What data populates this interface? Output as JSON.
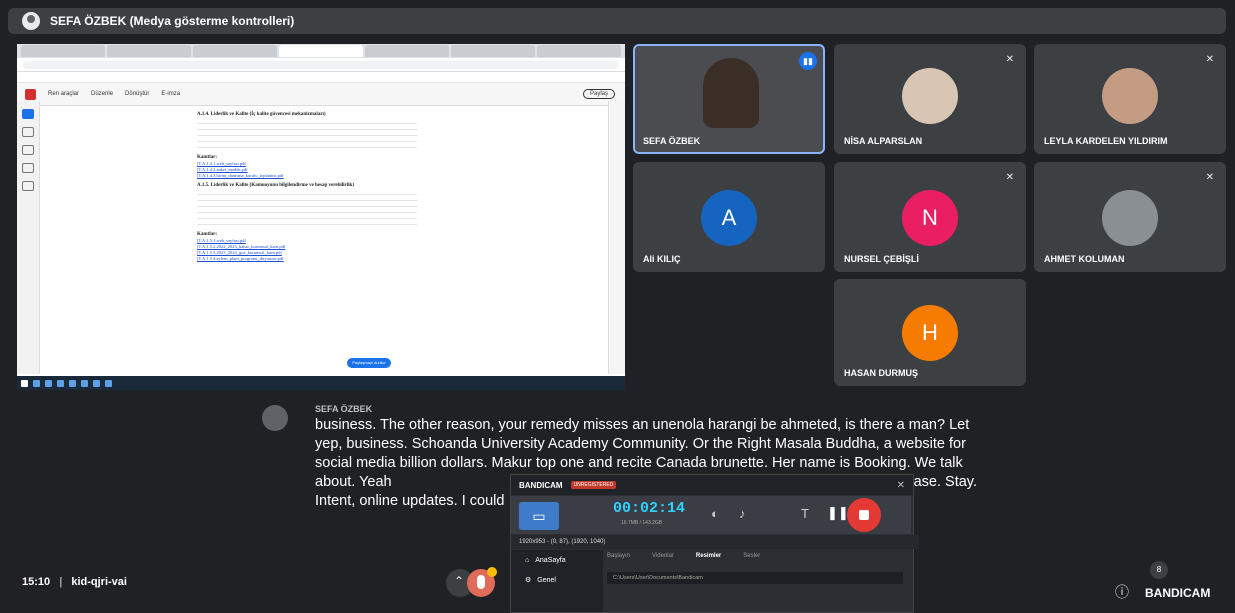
{
  "meeting": {
    "presenter_title": "SEFA ÖZBEK (Medya gösterme kontrolleri)",
    "clock": "15:10",
    "separator": "|",
    "code": "kid-qjri-vai",
    "people_count": "8"
  },
  "participants": [
    {
      "name": "SEFA ÖZBEK",
      "type": "video",
      "speaking": true
    },
    {
      "name": "NİSA ALPARSLAN",
      "type": "photo",
      "muted": true
    },
    {
      "name": "LEYLA KARDELEN YILDIRIM",
      "type": "photo",
      "muted": true
    },
    {
      "name": "Ali KILIÇ",
      "initial": "A",
      "color": "#1565c0",
      "type": "letter"
    },
    {
      "name": "NURSEL ÇEBİŞLİ",
      "initial": "N",
      "color": "#e91e63",
      "type": "letter",
      "muted": true
    },
    {
      "name": "AHMET KOLUMAN",
      "type": "photo",
      "muted": true
    },
    {
      "name": "HASAN DURMUŞ",
      "initial": "H",
      "color": "#f57c00",
      "type": "letter"
    }
  ],
  "caption": {
    "speaker": "SEFA ÖZBEK",
    "text": "business. The other reason, your remedy misses an unenola harangi be ahmeted, is there a man? Let yep, business. Schoanda University Academy Community. Or the Right Masala Buddha, a website for social media billion dollars. Makur top one and recite Canada brunette. Her name is Booking. We talk about. Yeah",
    "text_tail": "ease. Stay.",
    "text_line5": "Intent, online updates. I could"
  },
  "shared_screen": {
    "pdf_menu": [
      "Ren araçlar",
      "Düzenle",
      "Dönüştür",
      "E-imza"
    ],
    "pdf_tab": "Ücretsiz deneme",
    "pdf_button": "Paylaş",
    "section1": "A.1.4. Liderlik ve Kalite (İç kalite güvencesi mekanizmaları)",
    "section2": "A.1.5. Liderlik ve Kalite (Kamuoyunu bilgilendirme ve hesap verebilirlik)",
    "evidence_label": "Kanıtlar:",
    "links1": [
      "[T.A.1.4.1.web_sayfasi.pdf",
      "[T.A.1.4.2.anket_madde.pdf",
      "[T.A.1.4.3.birim_danisma_kurulu_toplantisi.pdf"
    ],
    "links2": [
      "[T.A.1.5.1.web_sayfasi.pdf",
      "[T.A.1.5.2.2022_2023_bahar_kurumsal_karn.pdf",
      "[T.A.1.5.3.2023_2024_guz_kurumsal_karn.pdf",
      "[T.A.1.5.4.eylem_plani_programi_duyurusu.pdf"
    ],
    "share_pill": "Paylaşmayı durdur"
  },
  "bandicam": {
    "brand": "BANDICAM",
    "unregistered": "UNREGISTERED",
    "timer": "00:02:14",
    "size": "16.7MB / 143.2GB",
    "area": "1920x953 - (0, 87), (1920, 1040)",
    "sidebar": [
      "AnaSayfa",
      "Genel"
    ],
    "tabs": [
      "Başlayın",
      "Videolar",
      "Resimler",
      "Sesler"
    ],
    "active_tab": "Resimler",
    "path": "C:\\Users\\User\\Documents\\Bandicam",
    "logo": "BANDICAM"
  },
  "colors": {
    "background": "#202124",
    "tile": "#3c4043",
    "speaking_outline": "#8ab4f8",
    "accent": "#1a73e8"
  }
}
